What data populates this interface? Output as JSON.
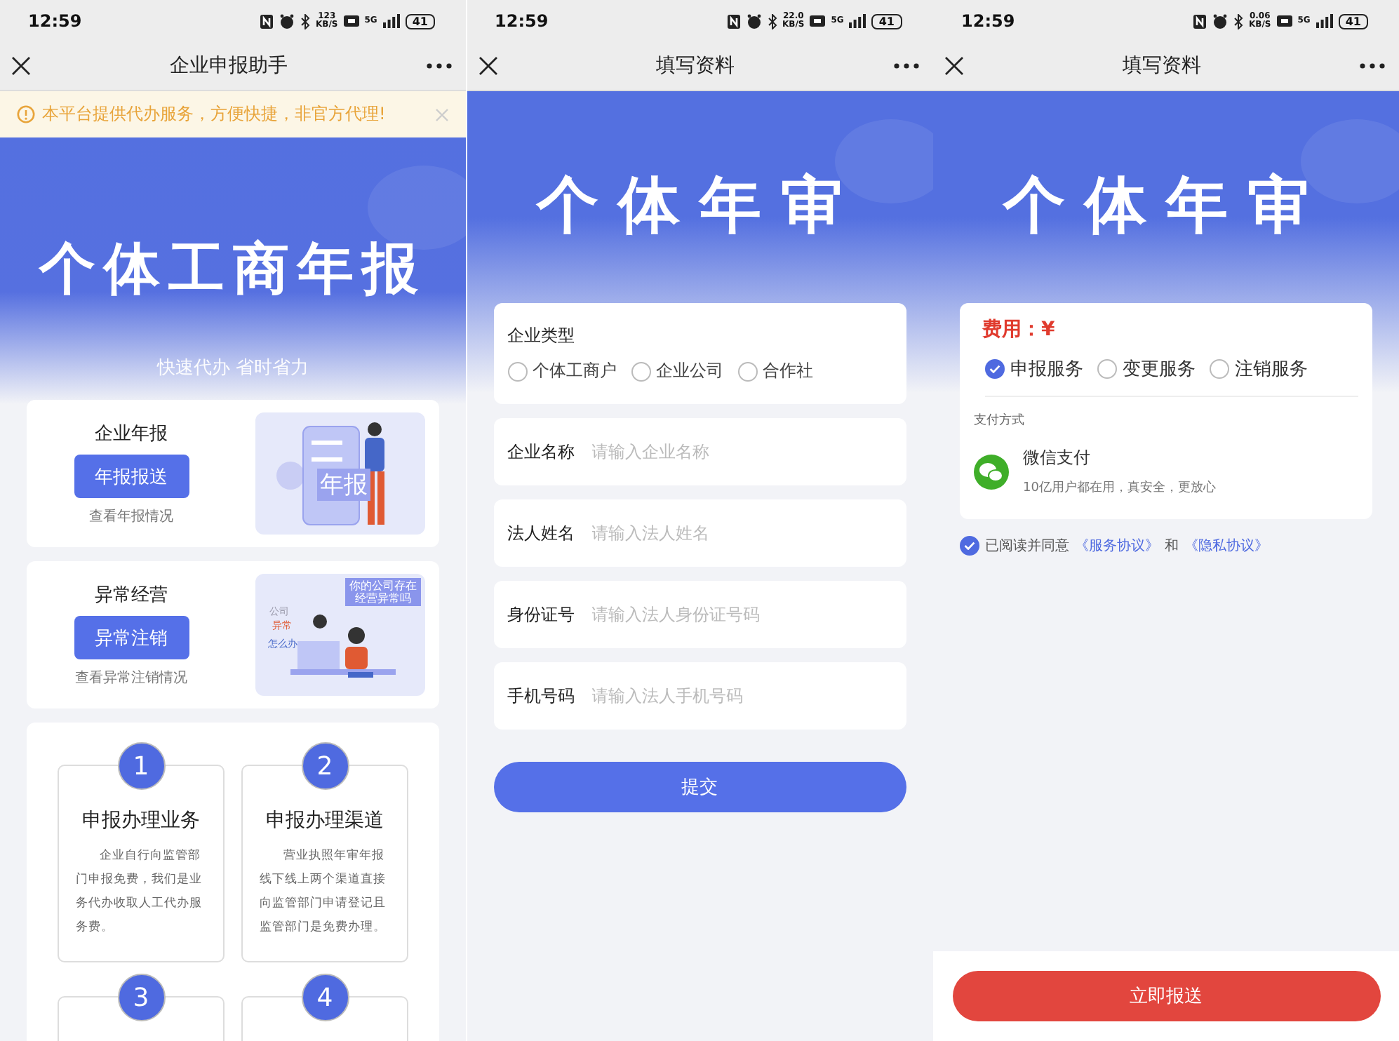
{
  "screens": [
    {
      "kind": "home",
      "status_bar": {
        "time": "12:59",
        "speed": "123",
        "speed_unit": "KB/S",
        "network": "5G",
        "battery": "41"
      },
      "title": "企业申报助手",
      "notice": "本平台提供代办服务，方便快捷，非官方代理!",
      "banner": {
        "title": "个体工商年报",
        "subtitle": "快速代办 省时省力"
      },
      "cards": [
        {
          "kind": "report",
          "title": "企业年报",
          "button": "年报报送",
          "link": "查看年报情况",
          "art_labels": [
            "年报"
          ]
        },
        {
          "kind": "abnormal",
          "title": "异常经营",
          "button": "异常注销",
          "link": "查看异常注销情况",
          "art_labels": [
            "公司",
            "异常",
            "怎么办",
            "你的公司存在经营异常吗"
          ]
        }
      ],
      "steps": [
        {
          "number": "1",
          "title": "申报办理业务",
          "text": "企业自行向监管部门申报免费，我们是业务代办收取人工代办服务费。"
        },
        {
          "number": "2",
          "title": "申报办理渠道",
          "text": "营业执照年审年报线下线上两个渠道直接向监管部门申请登记且监管部门是免费办理。"
        },
        {
          "number": "3"
        },
        {
          "number": "4"
        }
      ]
    },
    {
      "kind": "form",
      "status_bar": {
        "time": "12:59",
        "speed": "22.0",
        "speed_unit": "KB/S",
        "network": "5G",
        "battery": "41"
      },
      "title": "填写资料",
      "banner": {
        "title": "个体年审"
      },
      "type_field": {
        "label": "企业类型",
        "options": [
          {
            "label": "个体工商户",
            "selected": false
          },
          {
            "label": "企业公司",
            "selected": false
          },
          {
            "label": "合作社",
            "selected": false
          }
        ]
      },
      "fields": [
        {
          "label": "企业名称",
          "placeholder": "请输入企业名称"
        },
        {
          "label": "法人姓名",
          "placeholder": "请输入法人姓名"
        },
        {
          "label": "身份证号",
          "placeholder": "请输入法人身份证号码"
        },
        {
          "label": "手机号码",
          "placeholder": "请输入法人手机号码"
        }
      ],
      "submit": "提交"
    },
    {
      "kind": "payment",
      "status_bar": {
        "time": "12:59",
        "speed": "0.06",
        "speed_unit": "KB/S",
        "network": "5G",
        "battery": "41"
      },
      "title": "填写资料",
      "banner": {
        "title": "个体年审"
      },
      "fee_label": "费用：¥",
      "services": [
        {
          "label": "申报服务",
          "selected": true
        },
        {
          "label": "变更服务",
          "selected": false
        },
        {
          "label": "注销服务",
          "selected": false
        }
      ],
      "payment_heading": "支付方式",
      "payment": {
        "name": "微信支付",
        "note": "10亿用户都在用，真安全，更放心"
      },
      "agreement": {
        "checked": true,
        "text": "已阅读并同意",
        "link_1": "《服务协议》",
        "joiner": "和",
        "link_2": "《隐私协议》"
      },
      "submit": "立即报送"
    }
  ]
}
